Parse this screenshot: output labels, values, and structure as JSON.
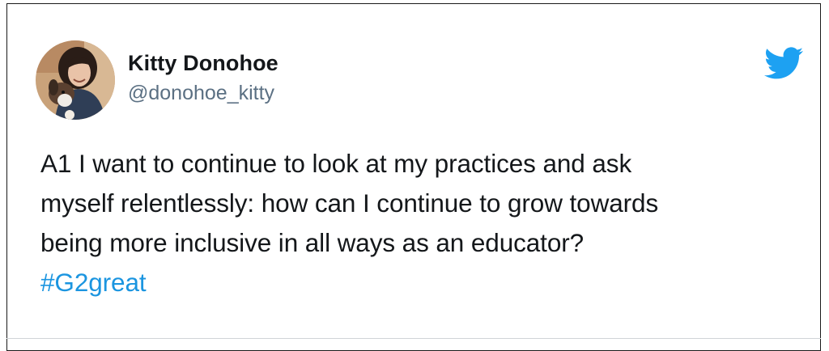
{
  "tweet": {
    "author": {
      "display_name": "Kitty Donohoe",
      "handle": "@donohoe_kitty",
      "avatar_icon": "avatar-photo"
    },
    "platform_icon": "twitter-bird-icon",
    "brand_color": "#1da1f2",
    "hashtag_color": "#1b95e0",
    "text_lines": [
      "A1 I want to continue to look at my practices and ask",
      "myself relentlessly: how can I continue to grow towards",
      "being more inclusive in all ways as an educator?"
    ],
    "hashtag": "#G2great"
  }
}
